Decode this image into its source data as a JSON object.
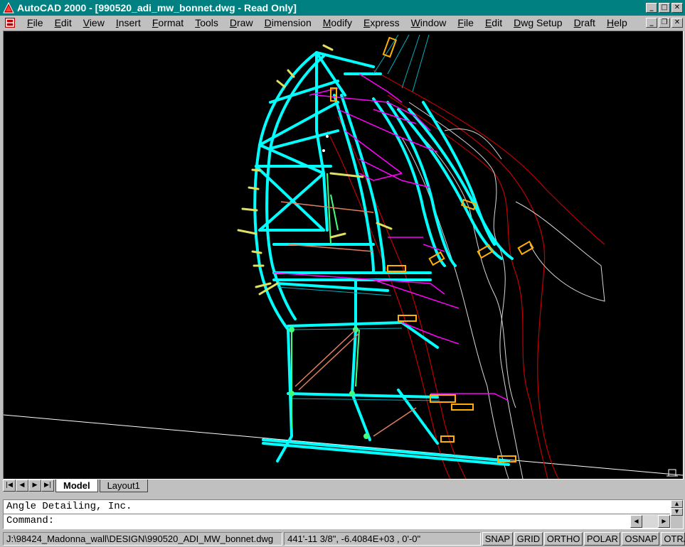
{
  "window": {
    "title": "AutoCAD 2000 - [990520_adi_mw_bonnet.dwg - Read Only]",
    "controls": [
      "_",
      "□",
      "✕"
    ]
  },
  "menu": {
    "items": [
      {
        "label": "File"
      },
      {
        "label": "Edit"
      },
      {
        "label": "View"
      },
      {
        "label": "Insert"
      },
      {
        "label": "Format"
      },
      {
        "label": "Tools"
      },
      {
        "label": "Draw"
      },
      {
        "label": "Dimension"
      },
      {
        "label": "Modify"
      },
      {
        "label": "Express"
      },
      {
        "label": "Window"
      },
      {
        "label": "File"
      },
      {
        "label": "Edit"
      },
      {
        "label": "Dwg Setup"
      },
      {
        "label": "Draft"
      },
      {
        "label": "Help"
      }
    ],
    "doc_controls": [
      "_",
      "❐",
      "✕"
    ]
  },
  "drawing": {
    "background": "#000000",
    "colors": {
      "cyan": "#00ffff",
      "green": "#40ff80",
      "magenta": "#ff00ff",
      "orange": "#ffb000",
      "red": "#c00000",
      "white": "#ffffff",
      "yellow": "#e0e060",
      "salmon": "#e08060"
    }
  },
  "tabs": {
    "nav": [
      "|◀",
      "◀",
      "▶",
      "▶|"
    ],
    "items": [
      {
        "label": "Model",
        "active": true
      },
      {
        "label": "Layout1",
        "active": false
      }
    ]
  },
  "command": {
    "history_line": "Angle Detailing, Inc.",
    "prompt": "Command:",
    "value": ""
  },
  "status": {
    "path": "J:\\98424_Madonna_wall\\DESIGN\\990520_ADI_MW_bonnet.dwg",
    "coords": "441'-11 3/8\", -6.4084E+03 , 0'-0\"",
    "toggles": [
      {
        "label": "SNAP"
      },
      {
        "label": "GRID"
      },
      {
        "label": "ORTHO"
      },
      {
        "label": "POLAR"
      },
      {
        "label": "OSNAP"
      },
      {
        "label": "OTRACK"
      }
    ]
  }
}
